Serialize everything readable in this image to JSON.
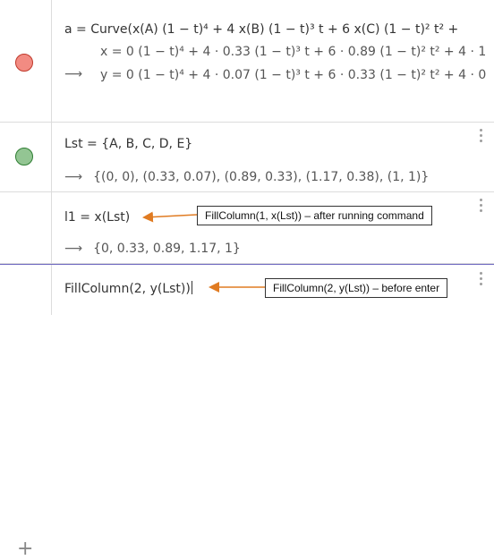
{
  "rows": [
    {
      "dot_color": "#f28b82",
      "input": "a = Curve(x(A) (1 − t)⁴ + 4 x(B) (1 − t)³ t + 6 x(C) (1 − t)² t² +",
      "output_line1": "x = 0 (1 − t)⁴ + 4 · 0.33 (1 − t)³ t + 6 · 0.89 (1 − t)² t² + 4 · 1",
      "output_line2": "y = 0 (1 − t)⁴ + 4 · 0.07 (1 − t)³ t + 6 · 0.33 (1 − t)² t² + 4 · 0"
    },
    {
      "dot_color": "#93c593",
      "input": "Lst = {A, B, C, D, E}",
      "output": "{(0, 0), (0.33, 0.07), (0.89, 0.33), (1.17, 0.38), (1, 1)}"
    },
    {
      "input": "l1 = x(Lst)",
      "output": "{0, 0.33, 0.89, 1.17, 1}"
    },
    {
      "input": "FillColumn(2,  y(Lst))"
    }
  ],
  "output_arrow": "⟶",
  "plus_label": "+",
  "callouts": {
    "after": "FillColumn(1, x(Lst)) – after running command",
    "before": "FillColumn(2, y(Lst)) – before enter"
  },
  "colors": {
    "callout_arrow": "#e07b22",
    "active_row_border": "#6d67c0"
  }
}
